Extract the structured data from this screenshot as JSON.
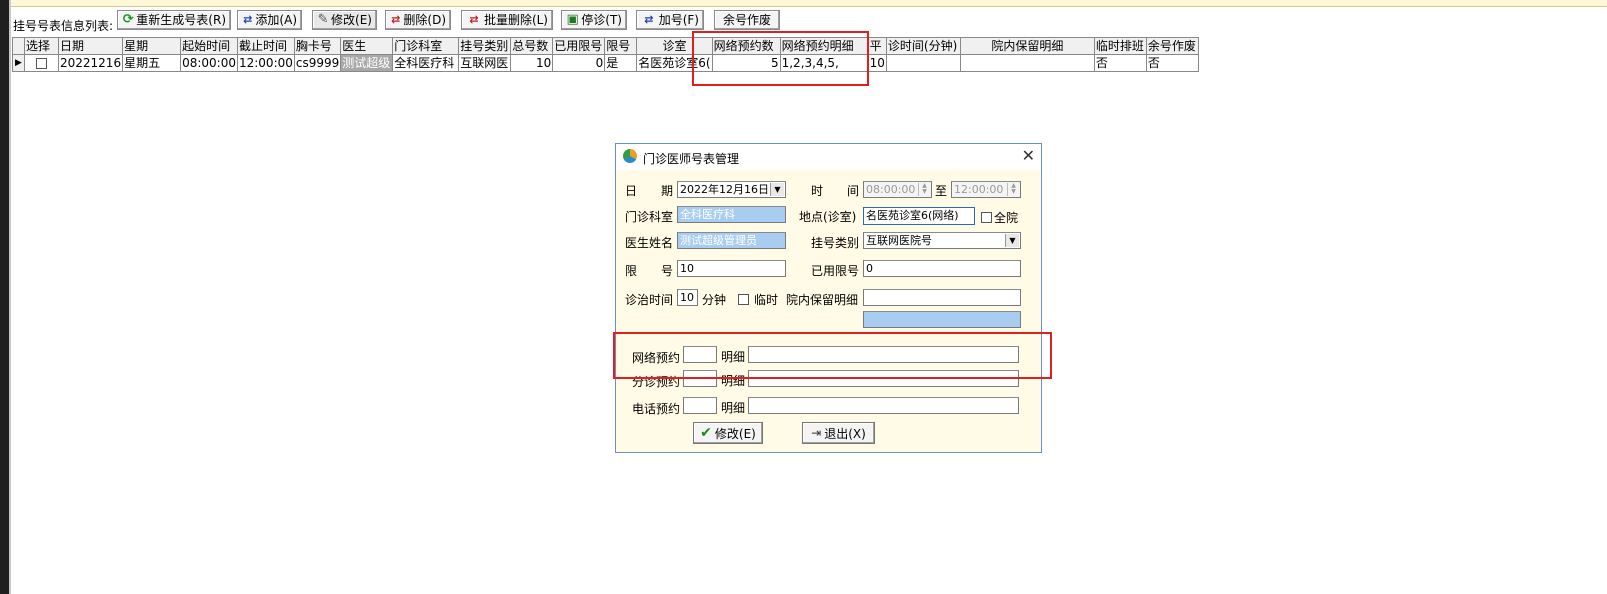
{
  "toolbar": {
    "list_label": "挂号号表信息列表:",
    "regenerate": "重新生成号表(R)",
    "add": "添加(A)",
    "modify": "修改(E)",
    "delete": "删除(D)",
    "batch_delete": "批量删除(L)",
    "stop": "停诊(T)",
    "add_number": "加号(F)",
    "void_remaining": "余号作废"
  },
  "table": {
    "columns": [
      "选择",
      "日期",
      "星期",
      "起始时间",
      "截止时间",
      "胸卡号",
      "医生",
      "门诊科室",
      "挂号类别",
      "总号数",
      "已用限号",
      "限号",
      "诊室",
      "网络预约数",
      "网络预约明细",
      "平",
      "诊时间(分钟)",
      "院内保留明细",
      "临时排班",
      "余号作废"
    ],
    "rows": [
      {
        "date": "20221216",
        "weekday": "星期五",
        "start": "08:00:00",
        "end": "12:00:00",
        "card": "cs9999",
        "doctor": "测试超级",
        "dept": "全科医疗科",
        "reg_type": "互联网医",
        "total": "10",
        "used": "0",
        "limited": "是",
        "room": "名医苑诊室6(",
        "net_count": "5",
        "net_detail": "1,2,3,4,5,",
        "avg": "10",
        "duration": "",
        "reserved": "",
        "temp": "否",
        "void": "否"
      }
    ]
  },
  "dialog": {
    "title": "门诊医师号表管理",
    "date_label": "日　　期",
    "date_value": "2022年12月16日",
    "time_label": "时　　间",
    "time_start": "08:00:00",
    "time_to": "至",
    "time_end": "12:00:00",
    "dept_label": "门诊科室",
    "dept_value": "全科医疗科",
    "location_label": "地点(诊室)",
    "location_value": "名医苑诊室6(网络)",
    "whole_hospital": "全院",
    "doctor_label": "医生姓名",
    "doctor_value": "测试超级管理员",
    "regtype_label": "挂号类别",
    "regtype_value": "互联网医院号",
    "limit_label": "限　　号",
    "limit_value": "10",
    "used_label": "已用限号",
    "used_value": "0",
    "duration_label": "诊治时间",
    "duration_value": "10",
    "minute_label": "分钟",
    "temp_label": "临时",
    "reserved_label": "院内保留明细",
    "net_label": "网络预约",
    "detail_label": "明细",
    "triage_label": "分诊预约",
    "phone_label": "电话预约",
    "modify_btn": "修改(E)",
    "exit_btn": "退出(X)"
  }
}
